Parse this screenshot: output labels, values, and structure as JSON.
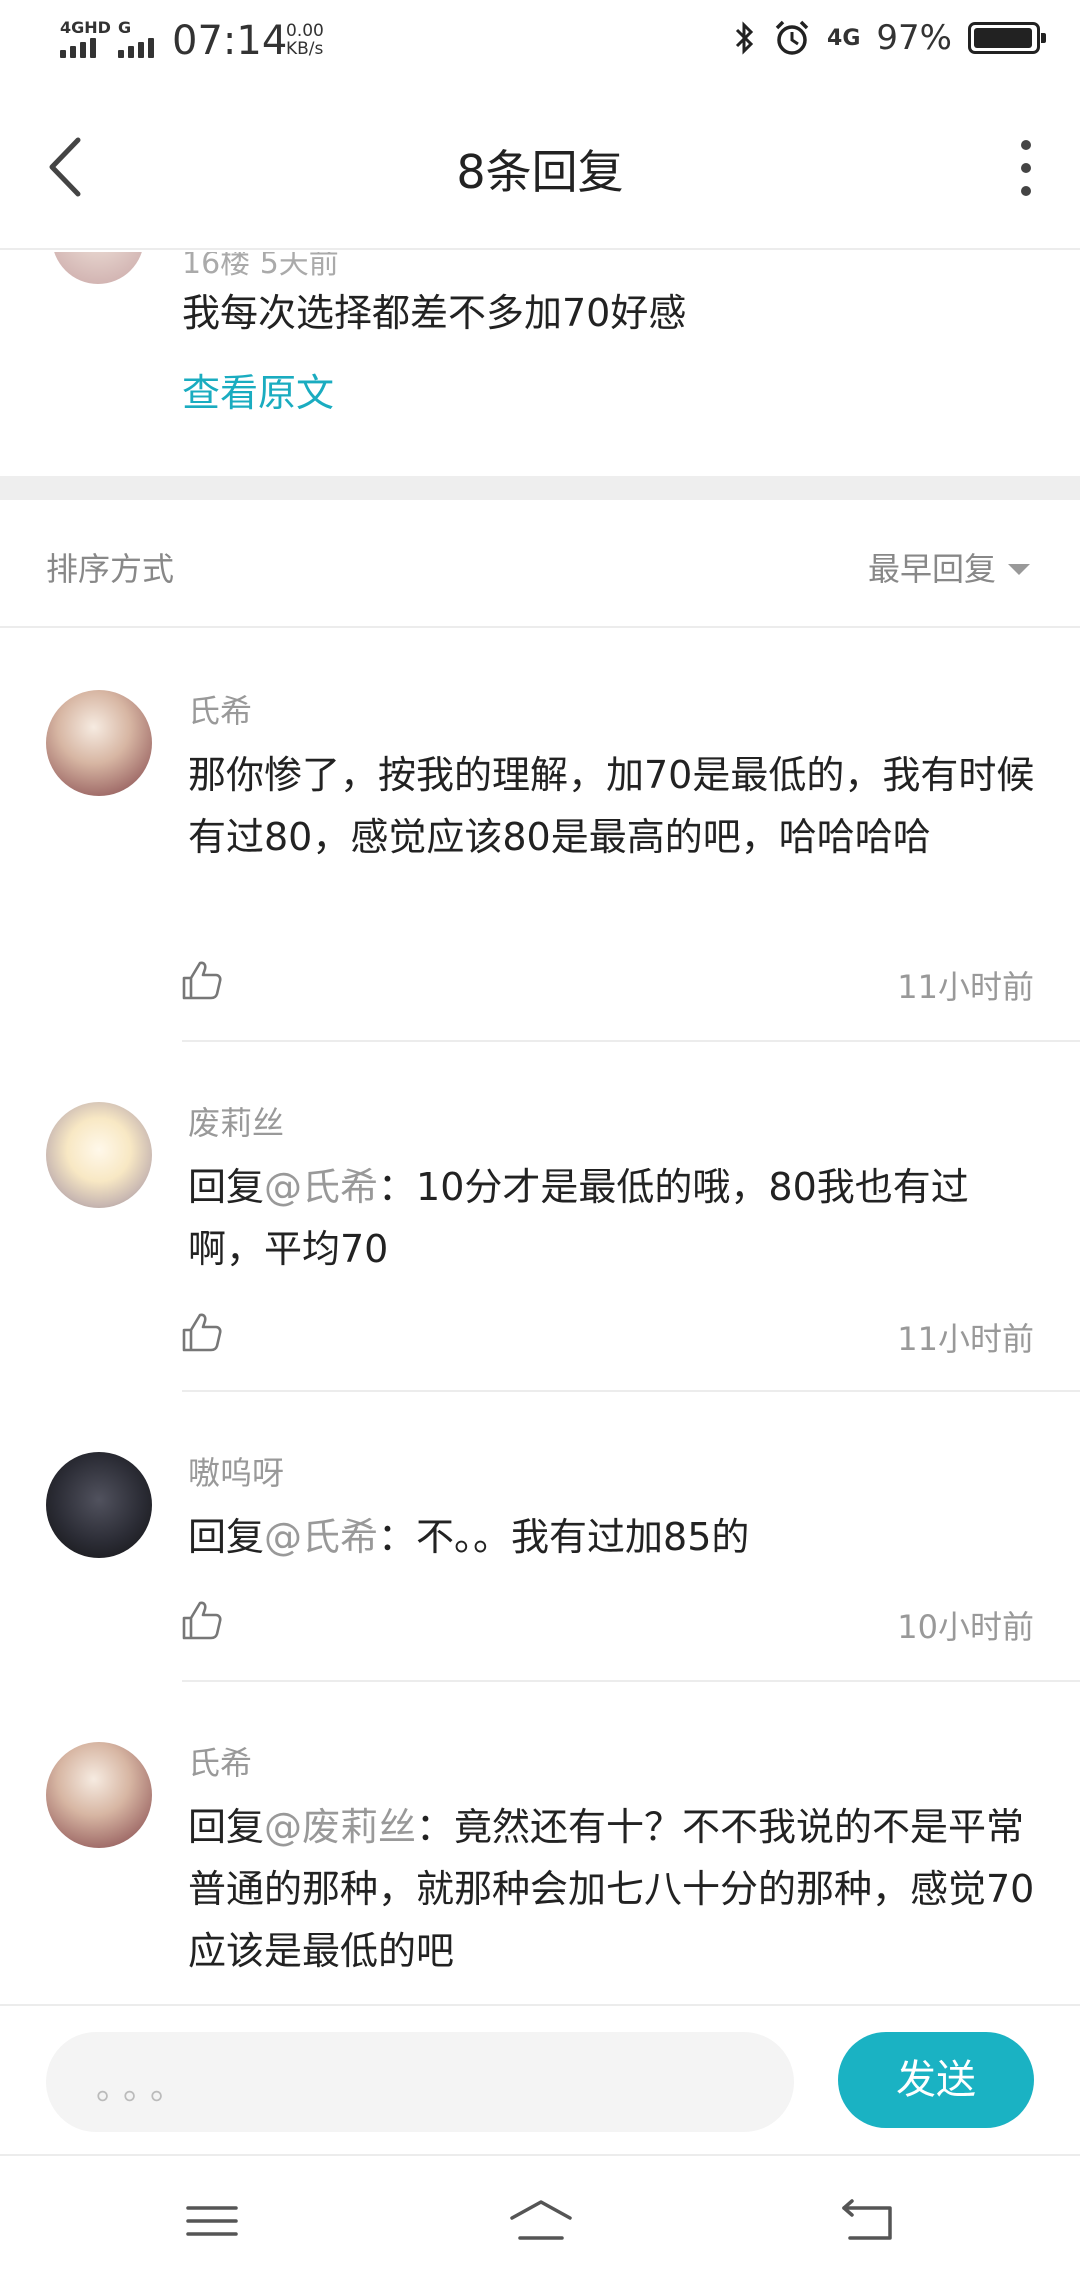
{
  "status_bar": {
    "network_1": "4GHD",
    "network_2": "G",
    "time": "07:14",
    "speed_value": "0.00",
    "speed_unit": "KB/s",
    "network_3": "4G",
    "battery": "97%",
    "battery_level": 0.97
  },
  "header": {
    "title": "8条回复"
  },
  "original_comment": {
    "meta_partial": "16楼  5天前",
    "text": "我每次选择都差不多加70好感",
    "view_original": "查看原文"
  },
  "sort": {
    "label": "排序方式",
    "value": "最早回复"
  },
  "replies": [
    {
      "name": "氏希",
      "body": "那你惨了，按我的理解，加70是最低的，我有时候有过80，感觉应该80是最高的吧，哈哈哈哈",
      "time": "11小时前"
    },
    {
      "name": "废莉丝",
      "prefix": "回复",
      "mention": "@氏希",
      "body": "：10分才是最低的哦，80我也有过啊，平均70",
      "time": "11小时前"
    },
    {
      "name": "嗷呜呀",
      "prefix": "回复",
      "mention": "@氏希",
      "body": "：不。。我有过加85的",
      "time": "10小时前"
    },
    {
      "name": "氏希",
      "prefix": "回复",
      "mention": "@废莉丝",
      "body": "：竟然还有十？不不我说的不是平常普通的那种，就那种会加七八十分的那种，感觉70应该是最低的吧"
    }
  ],
  "input": {
    "placeholder": "。。。",
    "send_label": "发送"
  },
  "colors": {
    "accent": "#1ab2c3",
    "link": "#1aacc0",
    "muted": "#999999"
  },
  "icons": [
    "back-icon",
    "more-icon",
    "caret-down-icon",
    "thumbs-up-icon",
    "menu-icon",
    "home-icon",
    "back-nav-icon",
    "bluetooth-icon",
    "alarm-icon",
    "battery-icon"
  ]
}
